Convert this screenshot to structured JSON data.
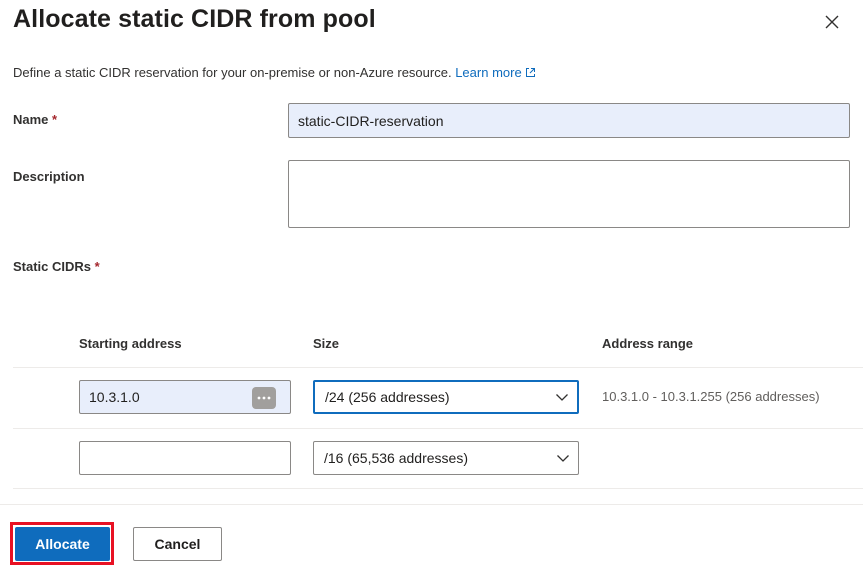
{
  "dialog": {
    "title": "Allocate static CIDR from pool",
    "description": "Define a static CIDR reservation for your on-premise or non-Azure resource.",
    "learn_more": "Learn more"
  },
  "form": {
    "name_label": "Name",
    "required_mark": "*",
    "name_value": "static-CIDR-reservation",
    "description_label": "Description",
    "description_value": "",
    "static_cidrs_label": "Static CIDRs"
  },
  "table": {
    "headers": {
      "starting_address": "Starting address",
      "size": "Size",
      "address_range": "Address range"
    },
    "rows": [
      {
        "starting_address": "10.3.1.0",
        "size": "/24 (256 addresses)",
        "address_range": "10.3.1.0 - 10.3.1.255 (256 addresses)"
      },
      {
        "starting_address": "",
        "size": "/16 (65,536 addresses)",
        "address_range": ""
      }
    ]
  },
  "footer": {
    "allocate_label": "Allocate",
    "cancel_label": "Cancel"
  },
  "colors": {
    "accent": "#0f6cbd",
    "highlight": "#e81123",
    "required": "#a4262c",
    "input_filled_bg": "#e8eefb"
  },
  "icons": {
    "close": "close-icon",
    "external_link": "external-link-icon",
    "more": "more-dots-icon",
    "chevron": "chevron-down-icon"
  }
}
